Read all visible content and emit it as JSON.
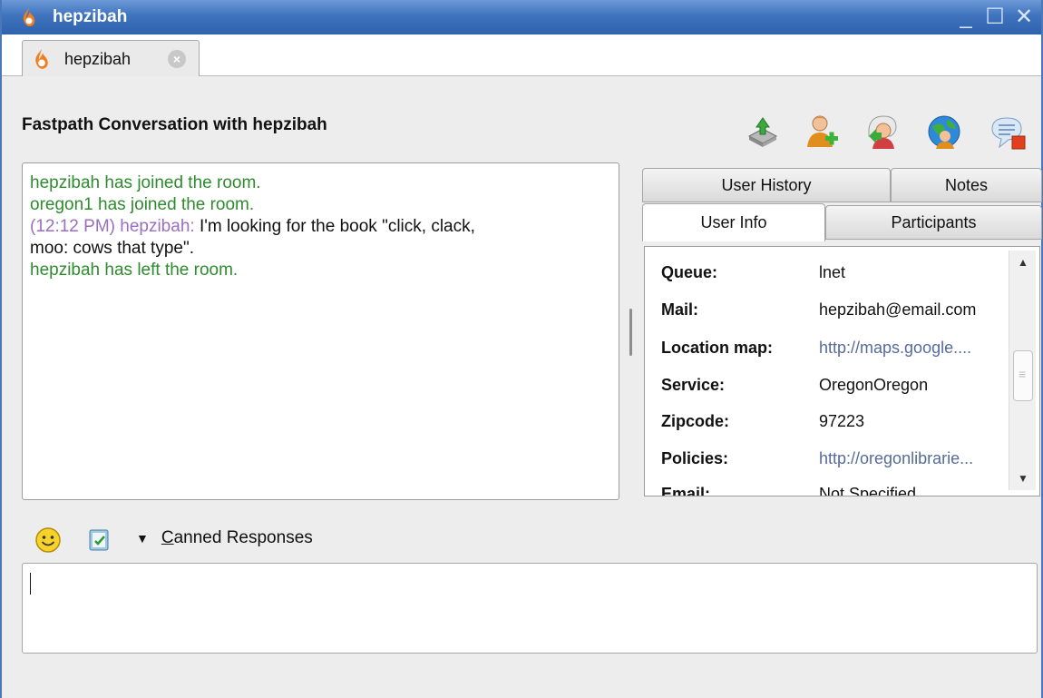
{
  "window": {
    "title": "hepzibah",
    "minimize_label": "_",
    "maximize_label": "☐",
    "close_label": "✕"
  },
  "conversation_tab": {
    "label": "hepzibah",
    "close_label": "×"
  },
  "header": {
    "title": "Fastpath Conversation with hepzibah",
    "tool_icons": [
      "transfer-icon",
      "invite-user-icon",
      "add-contact-icon",
      "cobrowse-icon",
      "end-chat-icon"
    ]
  },
  "chat": {
    "lines": [
      {
        "system": "hepzibah has joined the room."
      },
      {
        "system": "oregon1 has joined the room."
      },
      {
        "timestamp": "(12:12 PM) hepzibah:",
        "message": " I'm looking for the book \"click, clack,"
      },
      {
        "message": "moo: cows that type\"."
      },
      {
        "system": "hepzibah has left the room."
      }
    ]
  },
  "side_tabs": {
    "row1": [
      "User History",
      "Notes"
    ],
    "row2": [
      "User Info",
      "Participants"
    ],
    "active": "User Info"
  },
  "user_info": {
    "rows": [
      {
        "key": "Queue:",
        "value": "lnet",
        "link": false
      },
      {
        "key": "Mail:",
        "value": "hepzibah@email.com",
        "link": false
      },
      {
        "key": "Location map:",
        "value": "http://maps.google....",
        "link": true
      },
      {
        "key": "Service:",
        "value": "OregonOregon",
        "link": false
      },
      {
        "key": "Zipcode:",
        "value": "97223",
        "link": false
      },
      {
        "key": "Policies:",
        "value": "http://oregonlibrarie...",
        "link": true
      },
      {
        "key": "Email:",
        "value": "Not Specified",
        "link": false
      }
    ]
  },
  "composer": {
    "canned_label": "Canned Responses",
    "canned_mnemonic": "C",
    "canned_rest": "anned Responses",
    "value": ""
  },
  "colors": {
    "title_bar": "#3f73be",
    "system_text": "#2e8b2e",
    "timestamp_text": "#9a6fc0",
    "link_text": "#556b9b"
  }
}
